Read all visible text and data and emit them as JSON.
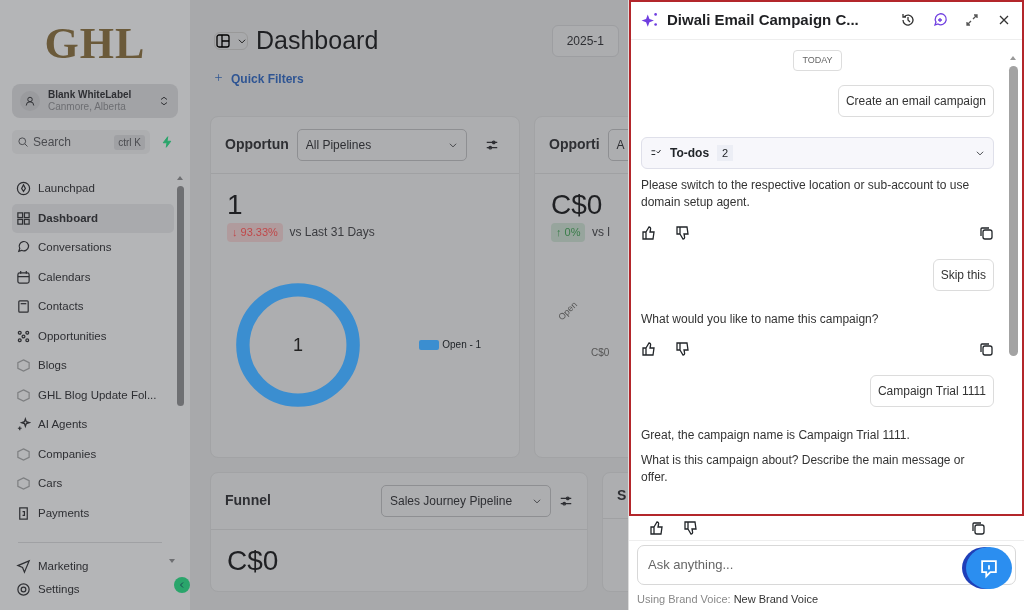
{
  "sidebar": {
    "logo": "GHL",
    "account": {
      "name": "Blank WhiteLabel",
      "location": "Canmore, Alberta"
    },
    "search": {
      "placeholder": "Search",
      "shortcut": "ctrl K"
    },
    "items": [
      {
        "label": "Launchpad",
        "selected": false
      },
      {
        "label": "Dashboard",
        "selected": true
      },
      {
        "label": "Conversations",
        "selected": false
      },
      {
        "label": "Calendars",
        "selected": false
      },
      {
        "label": "Contacts",
        "selected": false
      },
      {
        "label": "Opportunities",
        "selected": false
      },
      {
        "label": "Blogs",
        "selected": false
      },
      {
        "label": "GHL Blog Update Fol...",
        "selected": false
      },
      {
        "label": "AI Agents",
        "selected": false
      },
      {
        "label": "Companies",
        "selected": false
      },
      {
        "label": "Cars",
        "selected": false
      },
      {
        "label": "Payments",
        "selected": false
      }
    ],
    "bottom_items": [
      {
        "label": "Marketing",
        "selected": false
      },
      {
        "label": "Settings",
        "selected": false
      }
    ]
  },
  "main": {
    "title": "Dashboard",
    "date": "2025-1",
    "quick_filters": "Quick Filters",
    "cards": [
      {
        "title": "Opportun",
        "select": "All Pipelines",
        "value": "1",
        "change": "↓ 93.33%",
        "color": "#c0484a",
        "comparison": "vs Last 31 Days",
        "donut_center": "1",
        "legend": "Open - 1"
      },
      {
        "title": "Opporti",
        "select": "A",
        "value": "C$0",
        "change": "↑ 0%",
        "color": "#3a7d4a",
        "comparison": "vs l",
        "axis_label": "Open",
        "axis_value": "C$0"
      }
    ],
    "funnel": {
      "title": "Funnel",
      "select": "Sales Journey Pipeline",
      "value": "C$0"
    },
    "side_card": {
      "title": "S"
    }
  },
  "chat": {
    "title": "Diwali Email Campaign C...",
    "date_label": "TODAY",
    "messages": [
      {
        "kind": "user",
        "text": "Create an email campaign"
      },
      {
        "kind": "todos",
        "label": "To-dos",
        "count": "2"
      },
      {
        "kind": "bot",
        "texts": [
          "Please switch to the respective location or sub-account to use domain setup agent."
        ]
      },
      {
        "kind": "user",
        "text": "Skip this"
      },
      {
        "kind": "bot",
        "texts": [
          "What would you like to name this campaign?"
        ]
      },
      {
        "kind": "user",
        "text": "Campaign Trial 1111"
      },
      {
        "kind": "bot",
        "texts": [
          "Great, the campaign name is Campaign Trial 1111.",
          "What is this campaign about? Describe the main message or offer."
        ]
      }
    ],
    "input": {
      "placeholder": "Ask anything..."
    },
    "brand_voice": {
      "label": "Using Brand Voice:",
      "value": "New Brand Voice"
    }
  }
}
